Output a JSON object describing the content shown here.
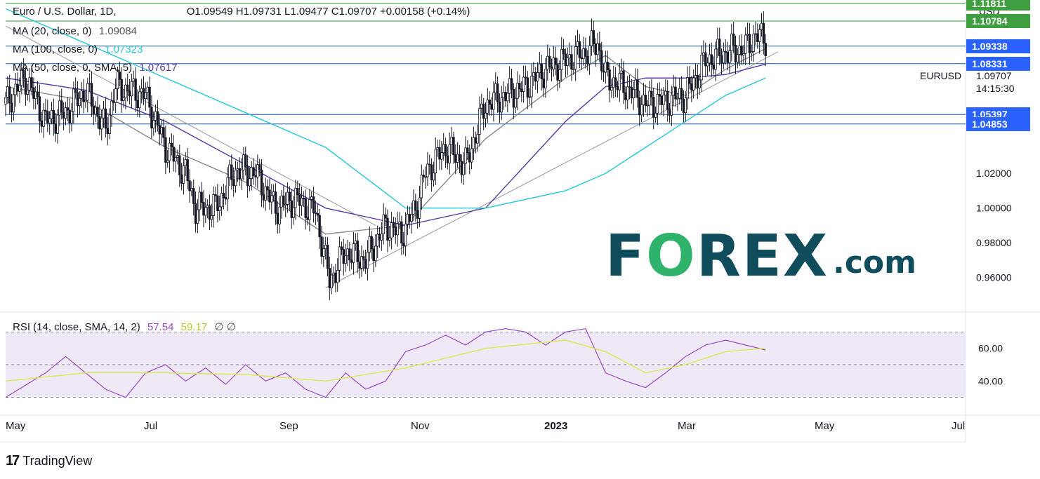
{
  "header": {
    "symbol": "Euro / U.S. Dollar, 1D,",
    "ohlc": "O1.09549  H1.09731  L1.09477  C1.09707  +0.00158 (+0.14%)",
    "ma20_label": "MA (20, close, 0)",
    "ma20_value": "1.09084",
    "ma100_label": "MA (100, close, 0)",
    "ma100_value": "1.07323",
    "ma50_label": "MA (50, close, 0, SMA, 5)",
    "ma50_value": "1.07617",
    "currency": "USD",
    "ticker": "EURUSD",
    "last_price": "1.09707",
    "countdown": "14:15:30"
  },
  "rsi_header": {
    "label": "RSI (14, close, SMA, 14, 2)",
    "value": "57.54",
    "sma_value": "59.17",
    "extra": "∅  ∅"
  },
  "brand": {
    "tradingview": "TradingView",
    "tv_mark": "17",
    "forex_f": "F",
    "forex_o": "O",
    "forex_rest": "REX",
    "forex_com": ".com"
  },
  "colors": {
    "ma20": "#8a8a8a",
    "ma100": "#26c6da",
    "ma50": "#5b3aa6",
    "up": "#ffffff",
    "down": "#131722",
    "level_green": "#2e9e3f",
    "level_blue": "#1f5aa8",
    "tag_green": "#3f9e40",
    "tag_blue": "#2962ff",
    "rsi": "#9c48c9",
    "rsi_sma": "#dce84f"
  },
  "chart_data": {
    "type": "candlestick",
    "title": "Euro / U.S. Dollar, 1D",
    "ylim": [
      0.94,
      1.12
    ],
    "y_ticks": [
      "1.02000",
      "1.00000",
      "0.98000",
      "0.96000"
    ],
    "x_ticks": [
      "May",
      "Jul",
      "Sep",
      "Nov",
      "2023",
      "Mar",
      "May",
      "Jul"
    ],
    "price_levels": [
      {
        "label": "1.11811",
        "value": 1.11811,
        "kind": "green"
      },
      {
        "label": "1.10784",
        "value": 1.10784,
        "kind": "green"
      },
      {
        "label": "1.09338",
        "value": 1.09338,
        "kind": "blue"
      },
      {
        "label": "1.08331",
        "value": 1.08331,
        "kind": "blue"
      },
      {
        "label": "1.05397",
        "value": 1.05397,
        "kind": "blue"
      },
      {
        "label": "1.04853",
        "value": 1.04853,
        "kind": "blue"
      }
    ],
    "close_path": [
      [
        0,
        1.06
      ],
      [
        10,
        1.075
      ],
      [
        20,
        1.05
      ],
      [
        30,
        1.055
      ],
      [
        40,
        1.068
      ],
      [
        50,
        1.045
      ],
      [
        55,
        1.07
      ],
      [
        70,
        1.065
      ],
      [
        80,
        1.035
      ],
      [
        90,
        1.02
      ],
      [
        95,
        1.0
      ],
      [
        105,
        1.0
      ],
      [
        115,
        1.022
      ],
      [
        125,
        1.02
      ],
      [
        135,
        1.0
      ],
      [
        145,
        1.005
      ],
      [
        155,
        0.998
      ],
      [
        162,
        0.958
      ],
      [
        170,
        0.975
      ],
      [
        180,
        0.97
      ],
      [
        190,
        0.99
      ],
      [
        198,
        0.985
      ],
      [
        205,
        1.0
      ],
      [
        210,
        1.02
      ],
      [
        220,
        1.035
      ],
      [
        230,
        1.025
      ],
      [
        240,
        1.06
      ],
      [
        250,
        1.065
      ],
      [
        260,
        1.07
      ],
      [
        270,
        1.08
      ],
      [
        280,
        1.085
      ],
      [
        290,
        1.09
      ],
      [
        296,
        1.095
      ],
      [
        300,
        1.075
      ],
      [
        310,
        1.07
      ],
      [
        320,
        1.06
      ],
      [
        330,
        1.062
      ],
      [
        340,
        1.065
      ],
      [
        350,
        1.085
      ],
      [
        360,
        1.09
      ],
      [
        370,
        1.092
      ],
      [
        375,
        1.1
      ],
      [
        380,
        1.097
      ]
    ],
    "trendlines": [
      {
        "from": [
          0,
          1.105
        ],
        "to": [
          185,
          0.99
        ]
      },
      {
        "from": [
          160,
          0.954
        ],
        "to": [
          386,
          1.09
        ]
      }
    ],
    "ma_series": [
      {
        "name": "MA (20, close, 0)",
        "values": [
          [
            0,
            1.07
          ],
          [
            40,
            1.062
          ],
          [
            80,
            1.035
          ],
          [
            120,
            1.015
          ],
          [
            160,
            0.985
          ],
          [
            200,
            0.99
          ],
          [
            240,
            1.04
          ],
          [
            280,
            1.075
          ],
          [
            300,
            1.088
          ],
          [
            320,
            1.07
          ],
          [
            340,
            1.065
          ],
          [
            360,
            1.08
          ],
          [
            380,
            1.092
          ]
        ]
      },
      {
        "name": "MA (50, close, 0, SMA, 5)",
        "values": [
          [
            0,
            1.075
          ],
          [
            40,
            1.068
          ],
          [
            80,
            1.05
          ],
          [
            120,
            1.025
          ],
          [
            160,
            1.0
          ],
          [
            200,
            0.99
          ],
          [
            240,
            1.0
          ],
          [
            280,
            1.05
          ],
          [
            300,
            1.07
          ],
          [
            320,
            1.075
          ],
          [
            340,
            1.075
          ],
          [
            360,
            1.077
          ],
          [
            380,
            1.083
          ]
        ]
      },
      {
        "name": "MA (100, close, 0)",
        "values": [
          [
            0,
            1.115
          ],
          [
            40,
            1.095
          ],
          [
            80,
            1.075
          ],
          [
            120,
            1.055
          ],
          [
            160,
            1.035
          ],
          [
            200,
            1.0
          ],
          [
            240,
            1.0
          ],
          [
            280,
            1.01
          ],
          [
            300,
            1.02
          ],
          [
            320,
            1.035
          ],
          [
            340,
            1.05
          ],
          [
            360,
            1.065
          ],
          [
            380,
            1.075
          ]
        ]
      }
    ],
    "rsi": {
      "ylim": [
        20,
        80
      ],
      "ticks": [
        "60.00",
        "40.00"
      ],
      "levels": [
        70,
        50,
        30
      ],
      "values": [
        [
          0,
          30
        ],
        [
          20,
          45
        ],
        [
          30,
          55
        ],
        [
          40,
          45
        ],
        [
          50,
          35
        ],
        [
          60,
          30
        ],
        [
          70,
          45
        ],
        [
          80,
          50
        ],
        [
          90,
          40
        ],
        [
          100,
          48
        ],
        [
          110,
          38
        ],
        [
          120,
          50
        ],
        [
          130,
          40
        ],
        [
          140,
          45
        ],
        [
          150,
          35
        ],
        [
          160,
          30
        ],
        [
          170,
          45
        ],
        [
          180,
          35
        ],
        [
          190,
          40
        ],
        [
          200,
          58
        ],
        [
          210,
          62
        ],
        [
          220,
          68
        ],
        [
          230,
          62
        ],
        [
          240,
          70
        ],
        [
          250,
          72
        ],
        [
          260,
          70
        ],
        [
          270,
          62
        ],
        [
          280,
          70
        ],
        [
          290,
          72
        ],
        [
          300,
          45
        ],
        [
          310,
          40
        ],
        [
          320,
          36
        ],
        [
          330,
          45
        ],
        [
          340,
          55
        ],
        [
          350,
          62
        ],
        [
          360,
          65
        ],
        [
          370,
          62
        ],
        [
          380,
          59
        ]
      ],
      "sma_values": [
        [
          0,
          40
        ],
        [
          40,
          45
        ],
        [
          80,
          45
        ],
        [
          120,
          44
        ],
        [
          160,
          40
        ],
        [
          200,
          48
        ],
        [
          240,
          60
        ],
        [
          280,
          65
        ],
        [
          300,
          58
        ],
        [
          320,
          45
        ],
        [
          340,
          50
        ],
        [
          360,
          58
        ],
        [
          380,
          60
        ]
      ]
    }
  }
}
